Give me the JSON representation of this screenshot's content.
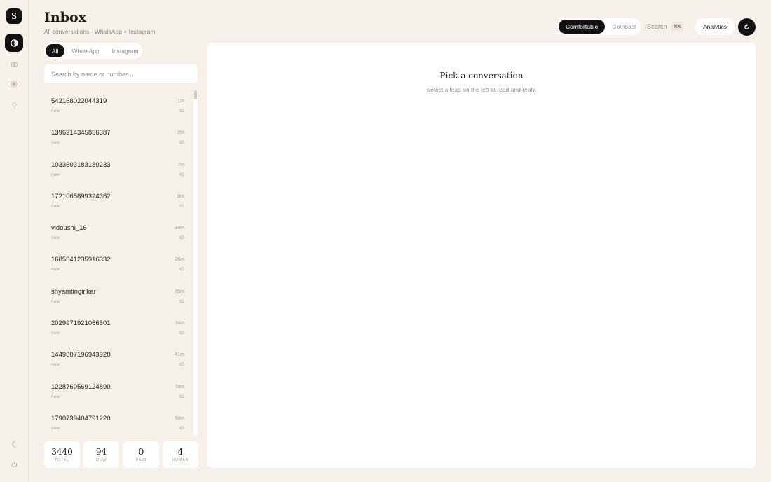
{
  "rail": {
    "logo": "S",
    "icons": [
      "inbox-icon",
      "link-icon",
      "sparkle-icon",
      "pin-icon",
      "moon-icon",
      "power-icon"
    ]
  },
  "header": {
    "title": "Inbox",
    "subtitle": "All conversations · WhatsApp + Instagram",
    "density": [
      "Comfortable",
      "Compact"
    ],
    "density_selected": "Comfortable",
    "search_label": "Search",
    "search_shortcut": "⌘K",
    "analytics_label": "Analytics"
  },
  "filters": {
    "channels": [
      "All",
      "WhatsApp",
      "Instagram"
    ],
    "selected": "All"
  },
  "search": {
    "placeholder": "Search by name or number…",
    "value": ""
  },
  "conversations": [
    {
      "name": "542168022044319",
      "time": "1m",
      "status": "new",
      "channel": "IG"
    },
    {
      "name": "1396214345856387",
      "time": "2m",
      "status": "new",
      "channel": "IG"
    },
    {
      "name": "1033603183180233",
      "time": "7m",
      "status": "new",
      "channel": "IG"
    },
    {
      "name": "1721065899324362",
      "time": "8m",
      "status": "new",
      "channel": "IG"
    },
    {
      "name": "vidoushi_16",
      "time": "18m",
      "status": "new",
      "channel": "IG"
    },
    {
      "name": "1685641235916332",
      "time": "26m",
      "status": "new",
      "channel": "IG"
    },
    {
      "name": "shyamtingirikar",
      "time": "35m",
      "status": "new",
      "channel": "IG"
    },
    {
      "name": "2029971921066601",
      "time": "36m",
      "status": "new",
      "channel": "IG"
    },
    {
      "name": "1449607196943928",
      "time": "41m",
      "status": "new",
      "channel": "IG"
    },
    {
      "name": "1228760569124890",
      "time": "48m",
      "status": "new",
      "channel": "IG"
    },
    {
      "name": "1790739404791220",
      "time": "58m",
      "status": "new",
      "channel": "IG"
    }
  ],
  "stats": [
    {
      "value": "3440",
      "label": "TOTAL"
    },
    {
      "value": "94",
      "label": "NEW"
    },
    {
      "value": "0",
      "label": "PAID"
    },
    {
      "value": "4",
      "label": "HUMAN"
    }
  ],
  "empty_state": {
    "title": "Pick a conversation",
    "subtitle": "Select a lead on the left to read and reply."
  },
  "colors": {
    "background": "#f5f1ea",
    "surface": "#ffffff",
    "accent_dark": "#141210",
    "muted_text": "#8f867b"
  }
}
